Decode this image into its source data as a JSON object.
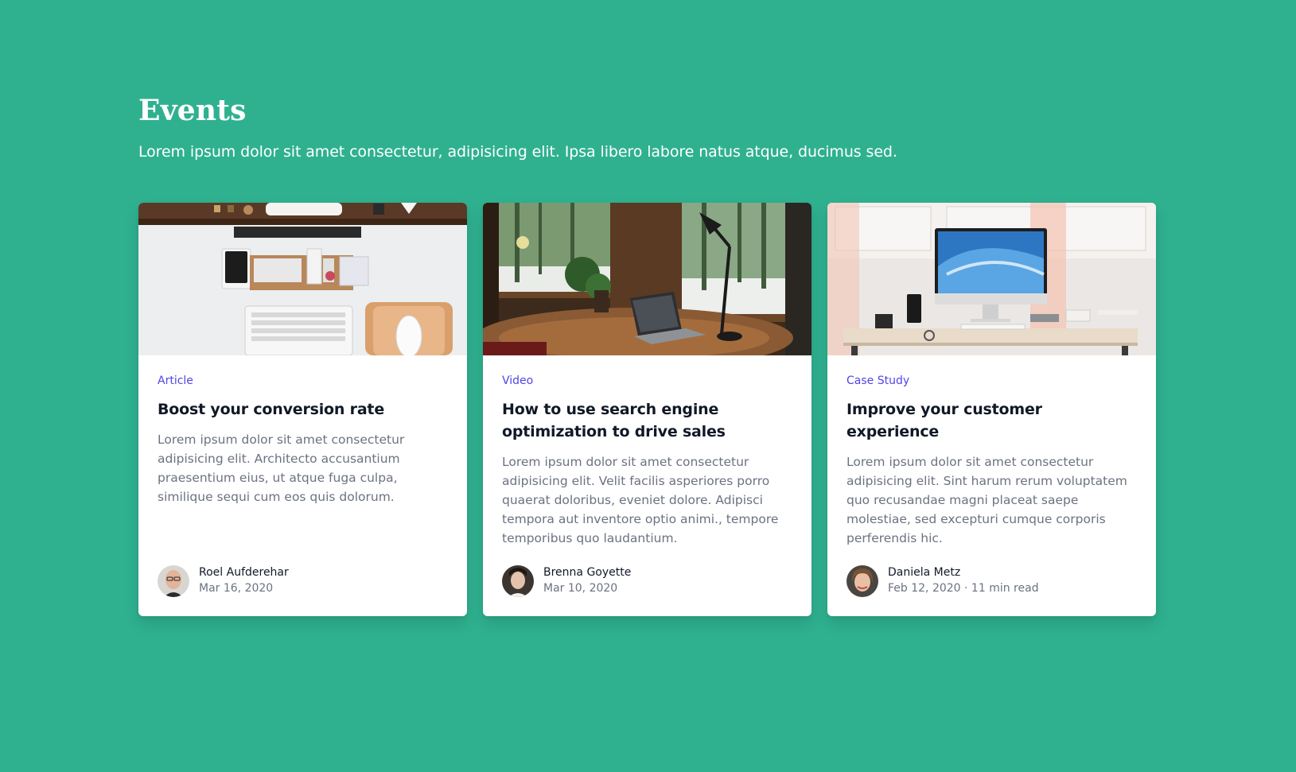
{
  "header": {
    "title": "Events",
    "subtitle": "Lorem ipsum dolor sit amet consectetur, adipisicing elit. Ipsa libero labore natus atque, ducimus sed."
  },
  "colors": {
    "background": "#2fb190",
    "accent": "#4f46e5",
    "card": "#ffffff"
  },
  "cards": [
    {
      "category": "Article",
      "title": "Boost your conversion rate",
      "description": "Lorem ipsum dolor sit amet consectetur adipisicing elit. Architecto accusantium praesentium eius, ut atque fuga culpa, similique sequi cum eos quis dolorum.",
      "author": "Roel Aufderehar",
      "meta": "Mar 16, 2020"
    },
    {
      "category": "Video",
      "title": "How to use search engine optimization to drive sales",
      "description": "Lorem ipsum dolor sit amet consectetur adipisicing elit. Velit facilis asperiores porro quaerat doloribus, eveniet dolore. Adipisci tempora aut inventore optio animi., tempore temporibus quo laudantium.",
      "author": "Brenna Goyette",
      "meta": "Mar 10, 2020"
    },
    {
      "category": "Case Study",
      "title": "Improve your customer experience",
      "description": "Lorem ipsum dolor sit amet consectetur adipisicing elit. Sint harum rerum voluptatem quo recusandae magni placeat saepe molestiae, sed excepturi cumque corporis perferendis hic.",
      "author": "Daniela Metz",
      "meta": "Feb 12, 2020 · 11 min read"
    }
  ]
}
